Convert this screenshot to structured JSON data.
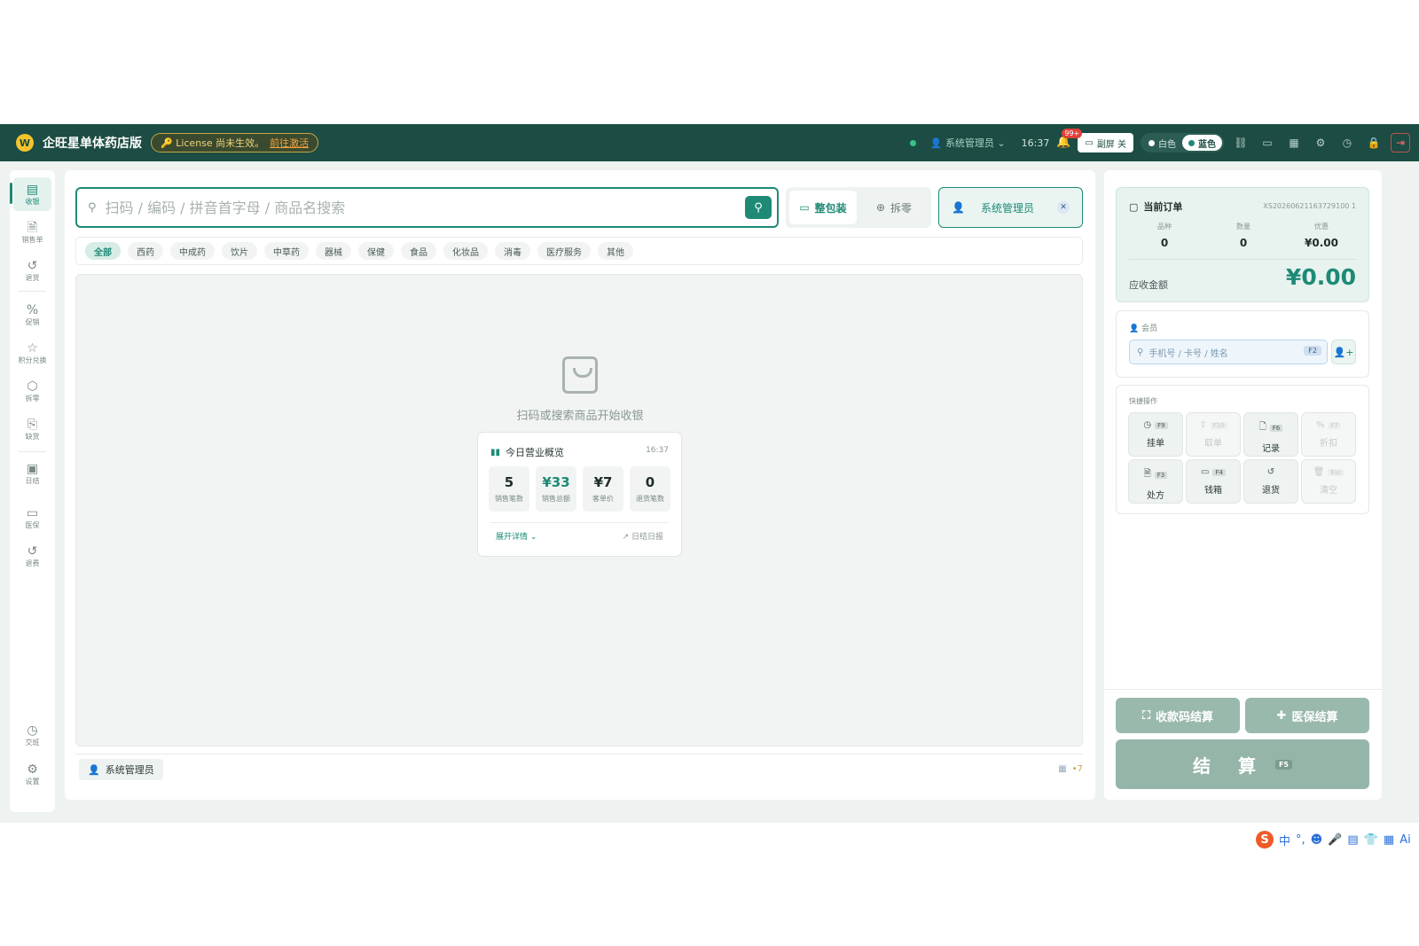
{
  "topbar": {
    "app_title": "企旺星单体药店版",
    "license_text": "License 尚未生效。",
    "license_action": "前往激活",
    "user": "系统管理员",
    "time": "16:37",
    "notif_badge": "99+",
    "screen_toggle": "副屏 关",
    "theme_white": "白色",
    "theme_blue": "蓝色"
  },
  "sidebar": {
    "items": [
      {
        "label": "收银",
        "icon": "cashier-icon",
        "active": true
      },
      {
        "label": "销售单",
        "icon": "document-icon"
      },
      {
        "label": "退货",
        "icon": "return-icon"
      },
      {
        "label": "促销",
        "icon": "percent-icon"
      },
      {
        "label": "积分兑换",
        "icon": "star-icon"
      },
      {
        "label": "拆零",
        "icon": "box-icon"
      },
      {
        "label": "缺货",
        "icon": "bookmark-icon"
      },
      {
        "label": "日结",
        "icon": "calendar-icon"
      },
      {
        "label": "医保",
        "icon": "card-icon"
      },
      {
        "label": "退费",
        "icon": "refund-icon"
      }
    ],
    "bottom": [
      {
        "label": "交班",
        "icon": "clock-icon"
      },
      {
        "label": "设置",
        "icon": "gear-icon"
      }
    ]
  },
  "search": {
    "placeholder": "扫码 / 编码 / 拼音首字母 / 商品名搜索"
  },
  "pack_mode": {
    "whole": "整包装",
    "split": "拆零",
    "active": "whole"
  },
  "cashier_chip": {
    "name": "系统管理员"
  },
  "categories": [
    "全部",
    "西药",
    "中成药",
    "饮片",
    "中草药",
    "器械",
    "保健",
    "食品",
    "化妆品",
    "消毒",
    "医疗服务",
    "其他"
  ],
  "empty_state": {
    "text": "扫码或搜索商品开始收银"
  },
  "today": {
    "title": "今日营业概览",
    "time": "16:37",
    "stats": [
      {
        "value": "5",
        "label": "销售笔数"
      },
      {
        "value": "¥33",
        "label": "销售总额"
      },
      {
        "value": "¥7",
        "label": "客单价"
      },
      {
        "value": "0",
        "label": "退货笔数"
      }
    ],
    "expand": "展开详情",
    "report": "日结日报"
  },
  "footer": {
    "user": "系统管理员",
    "count": "•7"
  },
  "order": {
    "title": "当前订单",
    "number": "XS20260621163729100 1",
    "cols": [
      {
        "label": "品种",
        "value": "0"
      },
      {
        "label": "数量",
        "value": "0"
      },
      {
        "label": "优惠",
        "value": "¥0.00"
      }
    ],
    "due_label": "应收金额",
    "due_amount": "¥0.00"
  },
  "member": {
    "title": "会员",
    "placeholder": "手机号 / 卡号 / 姓名",
    "shortcut": "F2"
  },
  "quick": {
    "title": "快捷操作",
    "buttons": [
      {
        "label": "挂单",
        "key": "F9",
        "icon": "clock-icon",
        "enabled": true
      },
      {
        "label": "取单",
        "key": "F10",
        "icon": "upload-icon",
        "enabled": false
      },
      {
        "label": "记录",
        "key": "F6",
        "icon": "file-icon",
        "enabled": true
      },
      {
        "label": "折扣",
        "key": "F7",
        "icon": "percent-icon",
        "enabled": false
      },
      {
        "label": "处方",
        "key": "F3",
        "icon": "prescription-icon",
        "enabled": true
      },
      {
        "label": "钱箱",
        "key": "F4",
        "icon": "cashbox-icon",
        "enabled": true
      },
      {
        "label": "退货",
        "key": "",
        "icon": "return-icon",
        "enabled": true
      },
      {
        "label": "清空",
        "key": "Esc",
        "icon": "trash-icon",
        "enabled": false
      }
    ]
  },
  "pay": {
    "qr": "收款码结算",
    "insurance": "医保结算",
    "settle": "结 算",
    "settle_key": "F5"
  },
  "ime": {
    "lang": "中"
  },
  "colors": {
    "primary": "#1e8a76",
    "topbar": "#1c4c43",
    "license": "#f3a33c"
  }
}
